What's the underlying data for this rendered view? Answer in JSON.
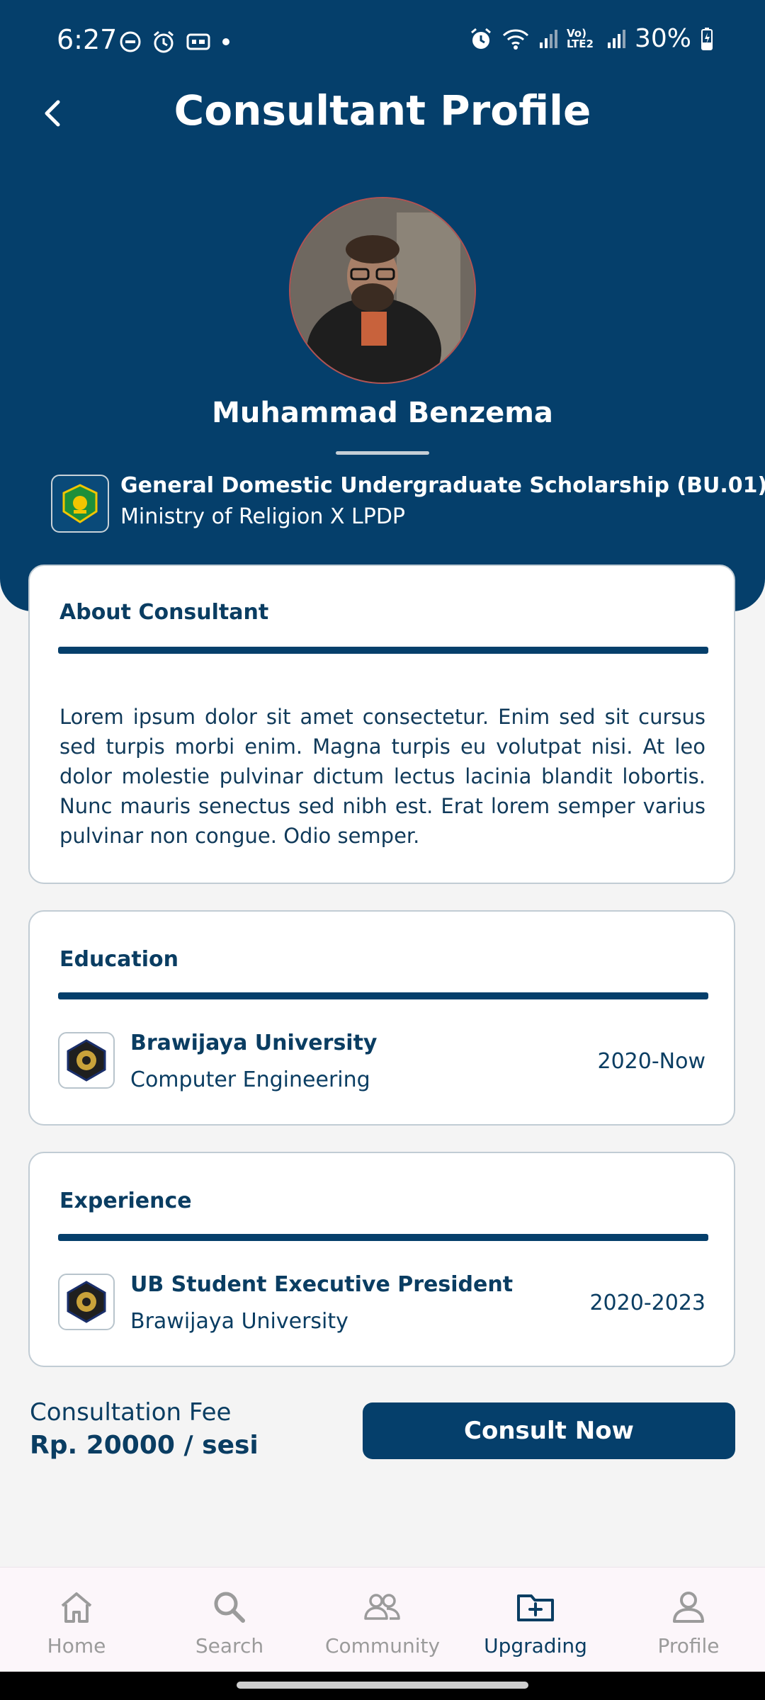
{
  "status_bar": {
    "time": "6:27",
    "battery": "30%",
    "network_label": "Vo) LTE2"
  },
  "header": {
    "title": "Consultant Profile",
    "background_color": "#053f6b"
  },
  "consultant": {
    "name": "Muhammad Benzema",
    "scholarship_title": "General Domestic Undergraduate  Scholarship (BU.01)",
    "scholarship_provider": "Ministry of Religion X LPDP"
  },
  "about": {
    "title": "About Consultant",
    "text": "Lorem ipsum dolor sit amet consectetur. Enim sed sit cursus sed turpis morbi enim. Magna turpis eu volutpat nisi. At leo dolor molestie pulvinar dictum lectus lacinia blandit lobortis. Nunc mauris senectus sed nibh est. Erat lorem semper varius pulvinar non congue. Odio semper."
  },
  "education": {
    "title": "Education",
    "items": [
      {
        "institution": "Brawijaya University",
        "major": "Computer Engineering",
        "period": "2020-Now"
      }
    ]
  },
  "experience": {
    "title": "Experience",
    "items": [
      {
        "role": "UB Student Executive President",
        "organization": "Brawijaya University",
        "period": "2020-2023"
      }
    ]
  },
  "fee": {
    "label": "Consultation Fee",
    "value": "Rp. 20000 / sesi"
  },
  "actions": {
    "consult_label": "Consult Now"
  },
  "bottom_nav": {
    "items": [
      {
        "label": "Home",
        "icon": "home-icon"
      },
      {
        "label": "Search",
        "icon": "search-icon"
      },
      {
        "label": "Community",
        "icon": "community-icon"
      },
      {
        "label": "Upgrading",
        "icon": "folder-plus-icon",
        "active": true
      },
      {
        "label": "Profile",
        "icon": "person-icon"
      }
    ]
  },
  "colors": {
    "primary": "#053f6b",
    "nav_active": "#0a3d62",
    "nav_inactive": "#9b9b9b"
  }
}
